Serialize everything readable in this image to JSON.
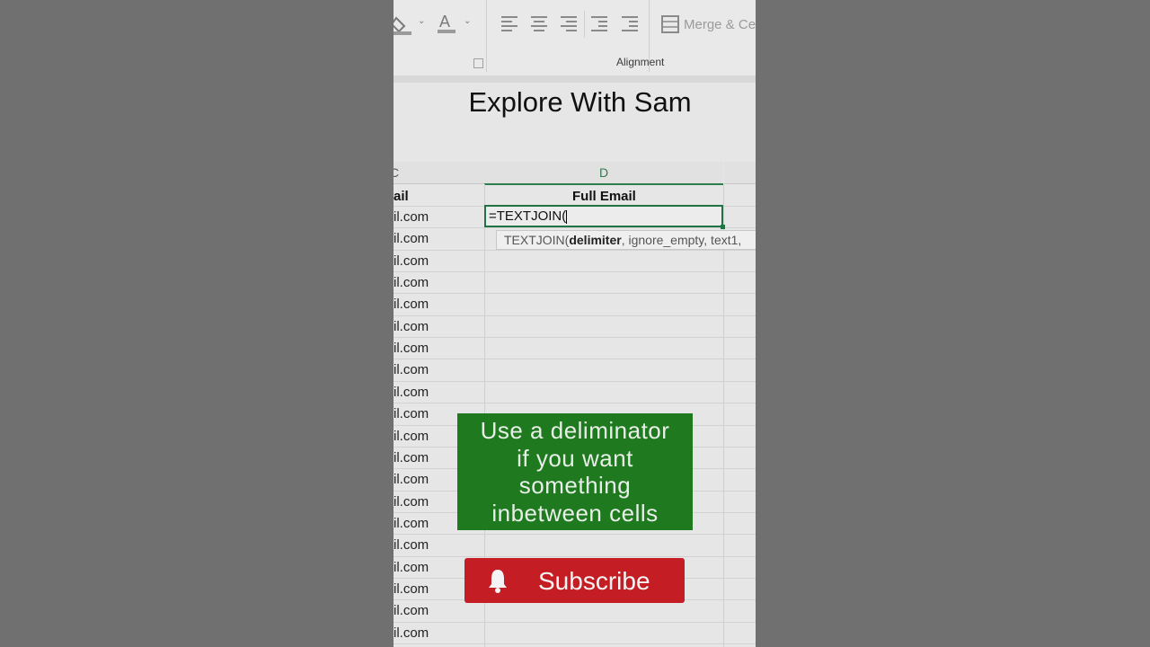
{
  "ribbon": {
    "merge_label": "Merge & Ce",
    "alignment_group_label": "Alignment",
    "icons": [
      "fill-color-icon",
      "font-color-icon",
      "align-left-icon",
      "align-center-icon",
      "align-right-icon",
      "decrease-indent-icon",
      "increase-indent-icon",
      "merge-cells-icon"
    ]
  },
  "video_title": "Explore With Sam",
  "sheet": {
    "column_c_header": "C",
    "column_d_header": "D",
    "c_header_cell": "ail",
    "d_header_cell": "Full Email",
    "c_cells": [
      "il.com",
      "il.com",
      "il.com",
      "il.com",
      "il.com",
      "il.com",
      "il.com",
      "il.com",
      "il.com",
      "il.com",
      "il.com",
      "il.com",
      "il.com",
      "il.com",
      "il.com",
      "il.com",
      "il.com",
      "il.com",
      "il.com",
      "il.com"
    ],
    "formula_text": "=TEXTJOIN(",
    "tooltip": {
      "func": "TEXTJOIN(",
      "bold_arg": "delimiter",
      "rest": ", ignore_empty, text1, "
    }
  },
  "callout": {
    "line1": "Use a deliminator",
    "line2": "if you want",
    "line3": "something",
    "line4": "inbetween cells",
    "color": "#1f7a1f"
  },
  "subscribe": {
    "label": "Subscribe",
    "color": "#c41e24"
  }
}
